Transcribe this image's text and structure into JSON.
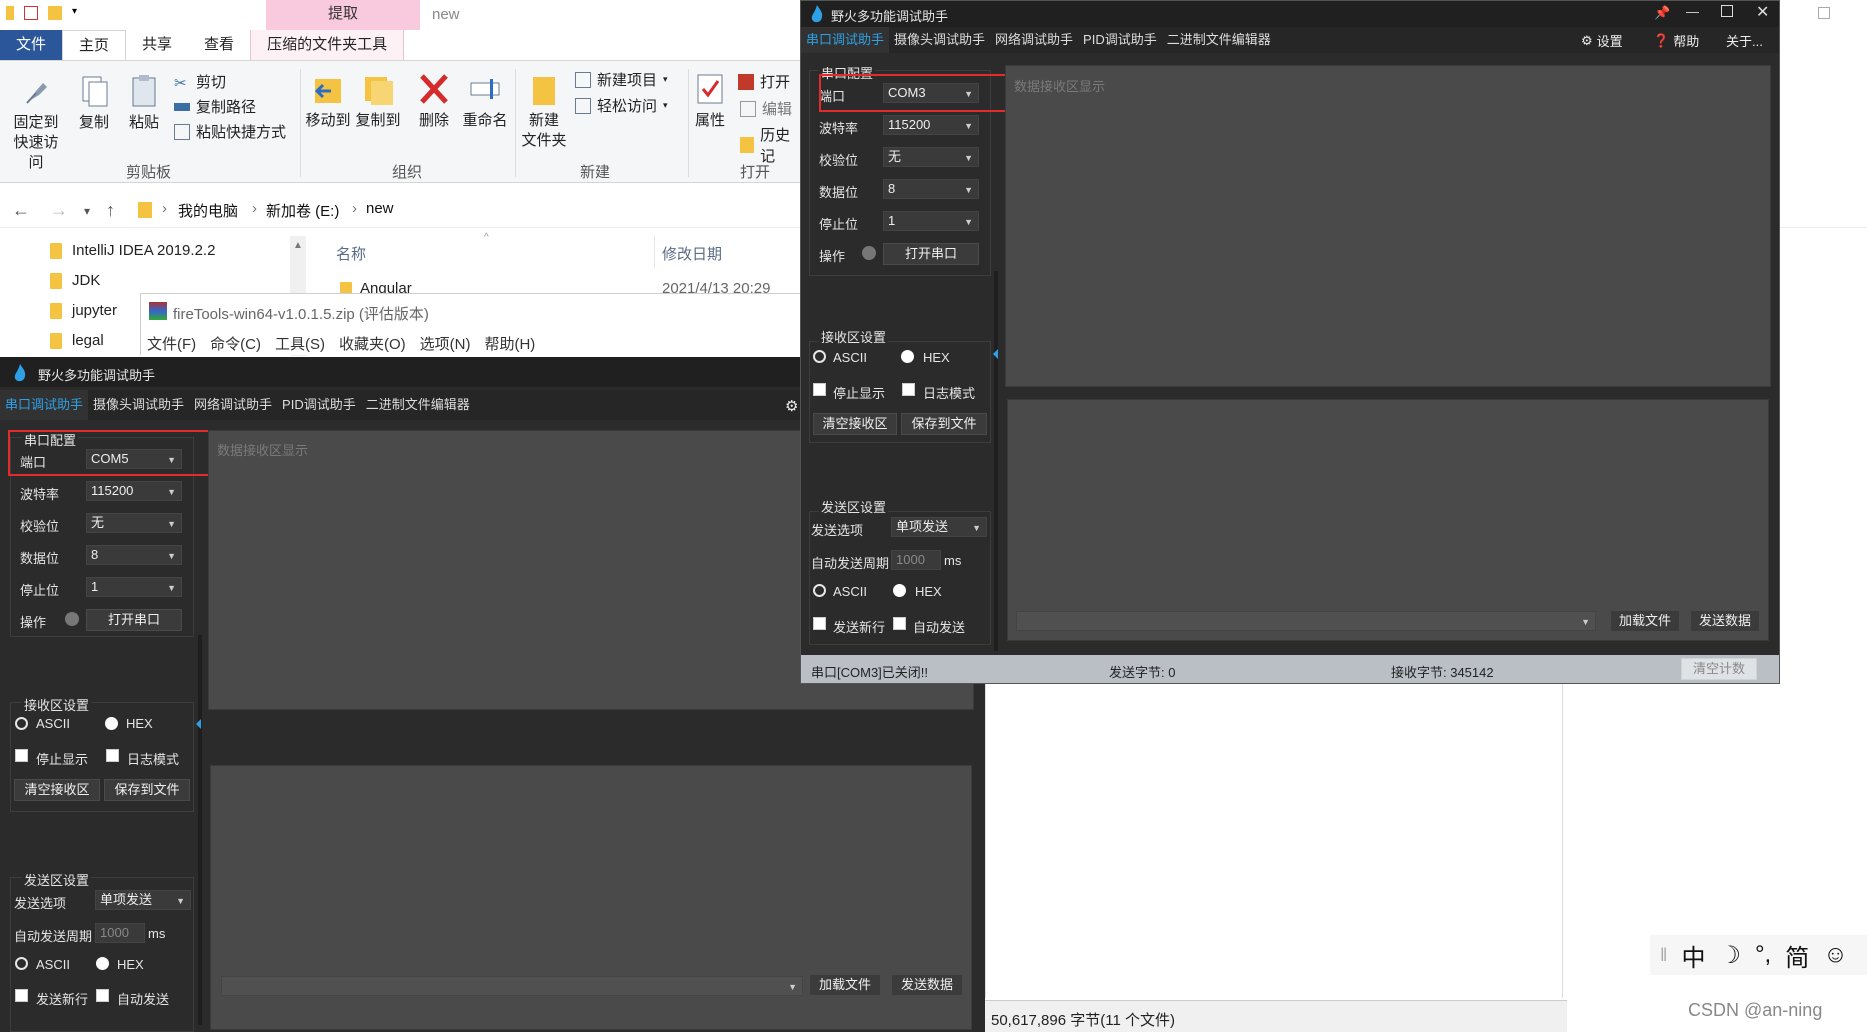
{
  "explorer": {
    "ribbon_context_tab": "提取",
    "window_title": "new",
    "tabs": [
      "文件",
      "主页",
      "共享",
      "查看",
      "压缩的文件夹工具"
    ],
    "clipboard": {
      "pin": "固定到\n快速访问",
      "copy": "复制",
      "paste": "粘贴",
      "cut": "剪切",
      "copy_path": "复制路径",
      "paste_shortcut": "粘贴快捷方式",
      "group": "剪贴板"
    },
    "organize": {
      "move_to": "移动到",
      "copy_to": "复制到",
      "delete": "删除",
      "rename": "重命名",
      "group": "组织"
    },
    "new": {
      "new_folder": "新建\n文件夹",
      "new_item": "新建项目",
      "easy_access": "轻松访问",
      "group": "新建"
    },
    "open": {
      "properties": "属性",
      "open": "打开",
      "edit": "编辑",
      "history": "历史记",
      "group": "打开"
    },
    "breadcrumb": [
      "我的电脑",
      "新加卷 (E:)",
      "new"
    ],
    "tree": [
      "IntelliJ IDEA 2019.2.2",
      "JDK",
      "jupyter",
      "legal"
    ],
    "columns": {
      "name": "名称",
      "date": "修改日期"
    },
    "first_row": {
      "name": "Angular",
      "date": "2021/4/13 20:29"
    },
    "status": "50,617,896 字节(11 个文件)"
  },
  "winrar": {
    "title": "fireTools-win64-v1.0.1.5.zip (评估版本)",
    "menu": [
      "文件(F)",
      "命令(C)",
      "工具(S)",
      "收藏夹(O)",
      "选项(N)",
      "帮助(H)"
    ]
  },
  "firetools": {
    "title": "野火多功能调试助手",
    "menu": [
      "串口调试助手",
      "摄像头调试助手",
      "网络调试助手",
      "PID调试助手",
      "二进制文件编辑器"
    ],
    "right_buttons": [
      "设置",
      "帮助",
      "关于..."
    ],
    "serial_group": "串口配置",
    "labels": {
      "port": "端口",
      "baud": "波特率",
      "parity": "校验位",
      "data": "数据位",
      "stop": "停止位",
      "op": "操作"
    },
    "values": {
      "baud": "115200",
      "parity": "无",
      "data": "8",
      "stop": "1"
    },
    "open_port": "打开串口",
    "recv_group": "接收区设置",
    "ascii": "ASCII",
    "hex": "HEX",
    "stop_display": "停止显示",
    "log_mode": "日志模式",
    "clear_recv": "清空接收区",
    "save_file": "保存到文件",
    "send_group": "发送区设置",
    "send_option_label": "发送选项",
    "send_option": "单项发送",
    "auto_period_label": "自动发送周期",
    "auto_period": "1000",
    "ms": "ms",
    "send_newline": "发送新行",
    "auto_send": "自动发送",
    "recv_placeholder": "数据接收区显示",
    "load_file": "加载文件",
    "send_data": "发送数据"
  },
  "ft_front": {
    "port": "COM3",
    "status_closed": "串口[COM3]已关闭!!",
    "sent_bytes": "发送字节: 0",
    "recv_bytes": "接收字节: 345142",
    "clear_count": "清空计数"
  },
  "ft_back": {
    "port": "COM5"
  },
  "ime": [
    "中",
    "☽",
    "°,",
    "简",
    "☺"
  ],
  "watermark": "CSDN @an-ning"
}
